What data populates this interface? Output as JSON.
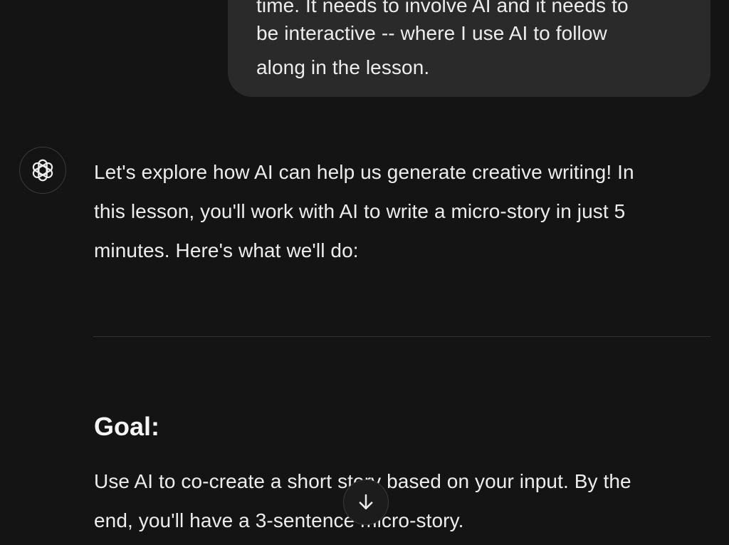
{
  "user_message": {
    "lines": [
      "time. It needs to involve AI and it needs to",
      "be interactive -- where I use AI to follow",
      "along in the lesson."
    ]
  },
  "assistant_message": {
    "avatar_icon": "openai-logo-icon",
    "intro_lines": [
      "Let's explore how AI can help us generate creative writing! In",
      "this lesson, you'll work with AI to write a micro-story in just 5",
      "minutes. Here's what we'll do:"
    ],
    "goal_heading": "Goal:",
    "goal_lines": [
      "Use AI to co-create a short story based on your input. By the",
      "end, you'll have a 3-sentence micro-story."
    ]
  },
  "scroll_button": {
    "icon": "arrow-down-icon"
  },
  "colors": {
    "background": "#141414",
    "user_bubble": "#2a2a2a",
    "text": "#ececec"
  }
}
